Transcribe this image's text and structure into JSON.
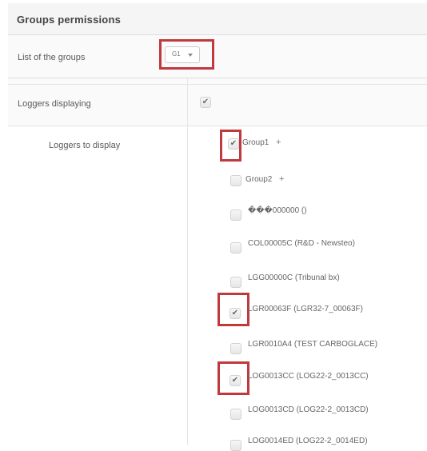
{
  "header": {
    "title": "Groups permissions"
  },
  "groups_row": {
    "label": "List of the groups",
    "selected": "G1"
  },
  "loggers_displaying": {
    "label": "Loggers displaying",
    "checked": true
  },
  "loggers_to_display": {
    "label": "Loggers to display",
    "groups": [
      {
        "label": "Group1",
        "expand": "+",
        "checked": true
      },
      {
        "label": "Group2",
        "expand": "+",
        "checked": false
      }
    ],
    "loggers": [
      {
        "label": "���000000 ()",
        "checked": false
      },
      {
        "label": "COL00005C (R&D - Newsteo)",
        "checked": false
      },
      {
        "label": "LGG00000C (Tribunal bx)",
        "checked": false
      },
      {
        "label": "LGR00063F (LGR32-7_00063F)",
        "checked": true
      },
      {
        "label": "LGR0010A4 (TEST CARBOGLACE)",
        "checked": false
      },
      {
        "label": "LOG0013CC (LOG22-2_0013CC)",
        "checked": true
      },
      {
        "label": "LOG0013CD (LOG22-2_0013CD)",
        "checked": false
      },
      {
        "label": "LOG0014ED (LOG22-2_0014ED)",
        "checked": false
      }
    ]
  },
  "check_glyph": "✔",
  "highlight_color": "#c0393d"
}
